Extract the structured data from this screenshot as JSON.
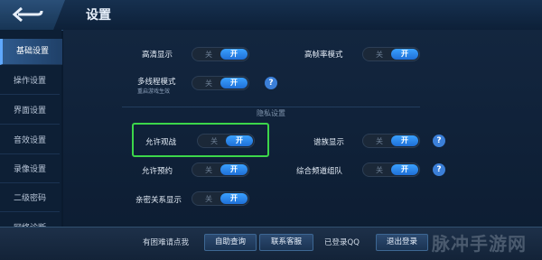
{
  "header": {
    "title": "设置"
  },
  "sidebar": {
    "items": [
      {
        "label": "基础设置",
        "active": true
      },
      {
        "label": "操作设置",
        "active": false
      },
      {
        "label": "界面设置",
        "active": false
      },
      {
        "label": "音效设置",
        "active": false
      },
      {
        "label": "录像设置",
        "active": false
      },
      {
        "label": "二级密码",
        "active": false
      },
      {
        "label": "网络诊断",
        "active": false
      }
    ]
  },
  "settings": {
    "off_label": "关",
    "on_label": "开",
    "help_label": "?",
    "hd_display": {
      "label": "高清显示",
      "state": "on"
    },
    "high_fps_mode": {
      "label": "高帧率模式",
      "state": "on"
    },
    "multithread_mode": {
      "label": "多线程模式",
      "sublabel": "重启游戏生效",
      "state": "on"
    },
    "privacy_section_title": "隐私设置",
    "allow_spectate": {
      "label": "允许观战",
      "state": "on"
    },
    "rank_display": {
      "label": "谱族显示",
      "state": "on"
    },
    "allow_reservation": {
      "label": "允许预约",
      "state": "on"
    },
    "comprehensive_channel": {
      "label": "综合频道组队",
      "state": "on"
    },
    "intimate_relation": {
      "label": "亲密关系显示",
      "state": "on"
    }
  },
  "footer": {
    "problem_text": "有困难请点我",
    "self_help_button": "自助查询",
    "contact_button": "联系客服",
    "qq_status": "已登录QQ",
    "logout_button": "退出登录"
  },
  "watermark": "脉冲手游网",
  "colors": {
    "accent": "#3aa1ff",
    "highlight_box": "#3cd64a"
  }
}
